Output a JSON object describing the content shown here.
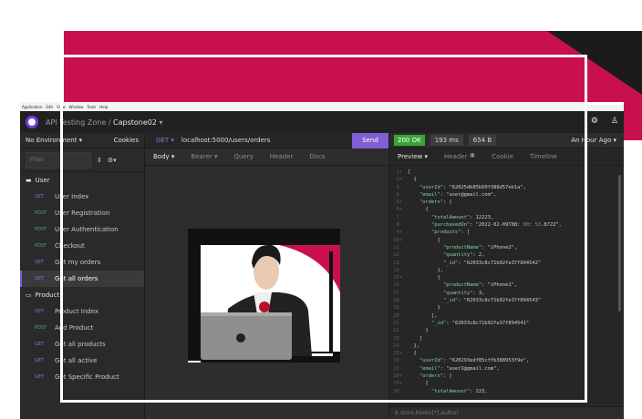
{
  "window": {
    "menu": [
      "Application",
      "Edit",
      "View",
      "Window",
      "Tools",
      "Help"
    ]
  },
  "app": {
    "project": "API Testing Zone",
    "workspace": "Capstone02"
  },
  "sidebar": {
    "environment": "No Environment",
    "cookies": "Cookies",
    "filter_placeholder": "Filter",
    "folders": [
      {
        "name": "User",
        "requests": [
          {
            "method": "GET",
            "label": "User Index"
          },
          {
            "method": "POST",
            "label": "User Registration"
          },
          {
            "method": "POST",
            "label": "User Authentication"
          },
          {
            "method": "POST",
            "label": "Checkout"
          },
          {
            "method": "GET",
            "label": "Get my orders"
          },
          {
            "method": "GET",
            "label": "Get all orders"
          }
        ]
      },
      {
        "name": "Product",
        "requests": [
          {
            "method": "GET",
            "label": "Product Index"
          },
          {
            "method": "POST",
            "label": "Add Product"
          },
          {
            "method": "GET",
            "label": "Get all products"
          },
          {
            "method": "GET",
            "label": "Get all active"
          },
          {
            "method": "GET",
            "label": "Get Specific Product"
          }
        ]
      }
    ]
  },
  "request": {
    "method": "GET",
    "url": "localhost:5000/users/orders",
    "send": "Send",
    "tabs": [
      "Body",
      "Bearer",
      "Query",
      "Header",
      "Docs"
    ]
  },
  "response": {
    "status": "200 OK",
    "time": "193 ms",
    "size": "654 B",
    "ago": "An Hour Ago",
    "tabs": [
      "Preview",
      "Header",
      "Cookie",
      "Timeline"
    ],
    "header_count": "8",
    "filter_placeholder": "$.store.books[*].author",
    "lines": [
      "[",
      "  {",
      "    \"userId\": \"62025db85b60f388d57eb1a\",",
      "    \"email\": \"user@gmail.com\",",
      "    \"orders\": [",
      "      {",
      "        \"totalAmount\": 12223,",
      "        \"purchasedOn\": \"2022-02-09T08:00:53.872Z\",",
      "        \"products\": [",
      "          {",
      "            \"productName\": \"iPhone2\",",
      "            \"quantity\": 2,",
      "            \"_id\": \"62033c8c71b92fe37f894542\"",
      "          },",
      "          {",
      "            \"productName\": \"iPhone1\",",
      "            \"quantity\": 3,",
      "            \"_id\": \"62033c8c71b92fe37f894543\"",
      "          }",
      "        ],",
      "        \"_id\": \"62033c8c71b92fe37f894541\"",
      "      }",
      "    ]",
      "  },",
      "  {",
      "    \"userId\": \"620293edf85cffb388953f9e\",",
      "    \"email\": \"user2@gmail.com\",",
      "    \"orders\": [",
      "      {",
      "        \"totalAmount\": 223,"
    ]
  },
  "colors": {
    "accent": "#7e5fd4",
    "ok": "#3ba536",
    "brand_bg": "#c8104e"
  }
}
